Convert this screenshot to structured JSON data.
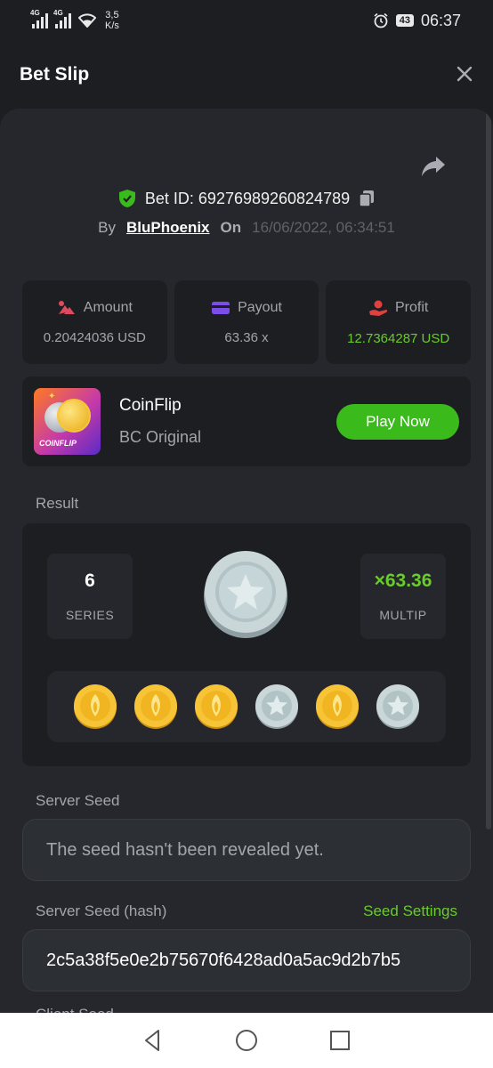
{
  "status_bar": {
    "signal1_tag": "4G",
    "signal2_tag": "4G",
    "net_speed_value": "3,5",
    "net_speed_unit": "K/s",
    "battery": "43",
    "time": "06:37"
  },
  "header": {
    "title": "Bet Slip"
  },
  "bet": {
    "id_label": "Bet ID:",
    "id": "69276989260824789",
    "by_label": "By",
    "user": "BluPhoenix",
    "on_label": "On",
    "date": "16/06/2022, 06:34:51"
  },
  "stats": [
    {
      "label": "Amount",
      "value": "0.20424036 USD",
      "icon": "coins-icon",
      "color": "#e04a5f"
    },
    {
      "label": "Payout",
      "value": "63.36 x",
      "icon": "card-icon",
      "color": "#7b4ee8"
    },
    {
      "label": "Profit",
      "value": "12.7364287 USD",
      "icon": "hand-coin-icon",
      "color": "#e0413f"
    }
  ],
  "game": {
    "name": "CoinFlip",
    "subtitle": "BC Original",
    "thumb_label": "COINFLIP",
    "play_label": "Play Now"
  },
  "result": {
    "section_label": "Result",
    "series_value": "6",
    "series_label": "SERIES",
    "multiplier_value": "×63.36",
    "multiplier_label": "MULTIP",
    "coins": [
      "gold",
      "gold",
      "gold",
      "silver",
      "gold",
      "silver"
    ]
  },
  "server_seed": {
    "label": "Server Seed",
    "value": "The seed hasn't been revealed yet."
  },
  "server_seed_hash": {
    "label": "Server Seed (hash)",
    "settings_link": "Seed Settings",
    "value": "2c5a38f5e0e2b75670f6428ad0a5ac9d2b7b5"
  },
  "next_section_label": "Client Seed",
  "colors": {
    "accent_green": "#3bba1c",
    "text_green": "#6acb2c",
    "bg": "#1c1e22",
    "panel": "#25272c"
  }
}
